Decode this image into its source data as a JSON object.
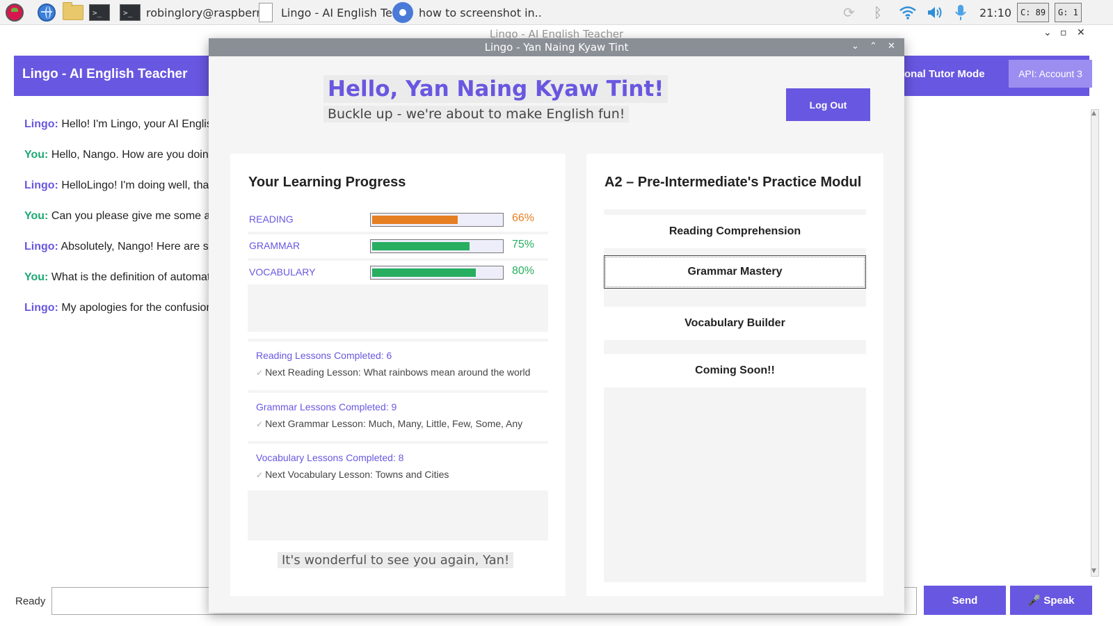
{
  "taskbar": {
    "tasks": [
      {
        "label": "robinglory@raspberr.."
      },
      {
        "label": "Lingo - AI English Te.."
      },
      {
        "label": "how to screenshot in.."
      }
    ],
    "clock": "21:10",
    "cpu_monitor": "C: 89",
    "gpu_monitor": "G: 1"
  },
  "app": {
    "window_title": "Lingo - AI English Teacher",
    "header_title": "Lingo - AI English Teacher",
    "mode_label": "onal Tutor Mode",
    "api_label": "API: Account 3"
  },
  "chat": {
    "messages": [
      {
        "speaker": "Lingo:",
        "text": "Hello! I'm Lingo, your AI English"
      },
      {
        "speaker": "You:",
        "text": "Hello, Nango. How are you doing"
      },
      {
        "speaker": "Lingo:",
        "text": "HelloLingo! I'm doing well, than"
      },
      {
        "speaker": "You:",
        "text": "Can you please give me some adv"
      },
      {
        "speaker": "Lingo:",
        "text": "Absolutely, Nango! Here are so"
      },
      {
        "speaker": "You:",
        "text": "What is the definition of automat"
      },
      {
        "speaker": "Lingo:",
        "text": "My apologies for the confusion,"
      }
    ]
  },
  "footer": {
    "status": "Ready",
    "input_value": "",
    "send_label": "Send",
    "speak_label": "🎤 Speak"
  },
  "dialog": {
    "title": "Lingo - Yan Naing Kyaw Tint",
    "greeting": "Hello, Yan Naing Kyaw Tint!",
    "subtitle": "Buckle up - we're about to make English fun!",
    "logout_label": "Log Out",
    "welcome": "It's wonderful to see you again, Yan!"
  },
  "progress": {
    "title": "Your Learning Progress",
    "items": [
      {
        "label": "READING",
        "percent": 66,
        "percent_text": "66%",
        "color": "#e67e22"
      },
      {
        "label": "GRAMMAR",
        "percent": 75,
        "percent_text": "75%",
        "color": "#27ae60"
      },
      {
        "label": "VOCABULARY",
        "percent": 80,
        "percent_text": "80%",
        "color": "#27ae60"
      }
    ]
  },
  "lessons": [
    {
      "completed": "Reading Lessons Completed: 6",
      "next": "Next Reading Lesson: What rainbows mean around the world"
    },
    {
      "completed": "Grammar Lessons Completed: 9",
      "next": "Next Grammar Lesson: Much, Many, Little, Few, Some, Any"
    },
    {
      "completed": "Vocabulary Lessons Completed: 8",
      "next": "Next Vocabulary Lesson: Towns and Cities"
    }
  ],
  "modules": {
    "title": "A2 – Pre-Intermediate's Practice Modul",
    "items": [
      {
        "label": "Reading Comprehension"
      },
      {
        "label": "Grammar Mastery"
      },
      {
        "label": "Vocabulary Builder"
      },
      {
        "label": "Coming Soon!!"
      }
    ]
  },
  "colors": {
    "accent": "#6857e0",
    "reading_bar": "#e67e22",
    "progress_bar": "#27ae60",
    "user_speaker": "#1fa875"
  }
}
